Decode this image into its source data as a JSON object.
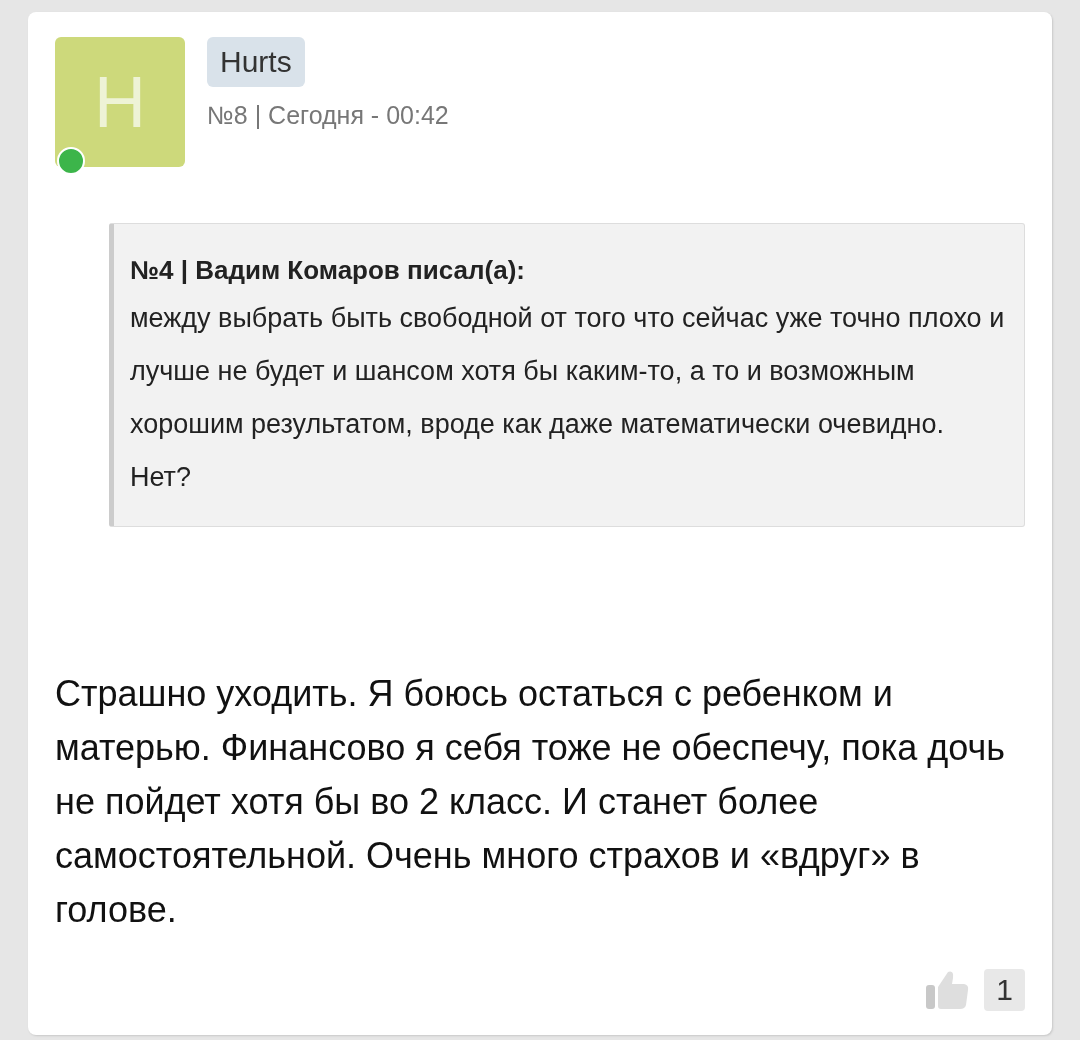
{
  "post": {
    "author": {
      "initial": "H",
      "name": "Hurts",
      "online": true
    },
    "meta": "№8 | Сегодня - 00:42",
    "quote": {
      "header": "№4 | Вадим Комаров писал(а):",
      "text": "между выбрать быть свободной от того что сейчас уже точно плохо и лучше не будет и шансом хотя бы каким-то, а то и возможным хорошим результатом, вроде как даже математически очевидно. Нет?"
    },
    "text": "Страшно уходить. Я боюсь остаться с ребенком и матерью. Финансово я себя тоже не обеспечу, пока дочь не пойдет хотя бы во 2 класс. И станет более самостоятельной. Очень много страхов и «вдруг» в голове.",
    "likes": "1"
  }
}
